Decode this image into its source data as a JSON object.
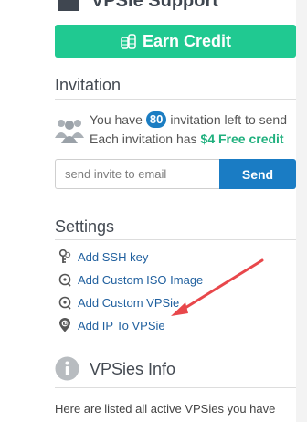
{
  "support": {
    "title": "VPSie Support",
    "icon": "headset-icon"
  },
  "earn": {
    "label": "Earn Credit",
    "icon": "coins-icon"
  },
  "invitation": {
    "title": "Invitation",
    "icon": "people-icon",
    "line1_prefix": "You have",
    "count": "80",
    "line1_suffix": "invitation left to send",
    "line2_prefix": "Each invitation has",
    "free_credit": "$4 Free credit",
    "input_placeholder": "send invite to email",
    "send_label": "Send"
  },
  "settings": {
    "title": "Settings",
    "items": [
      {
        "label": "Add SSH key",
        "icon": "key-icon"
      },
      {
        "label": "Add Custom ISO Image",
        "icon": "disc-icon"
      },
      {
        "label": "Add Custom VPSie",
        "icon": "disc-icon"
      },
      {
        "label": "Add IP To VPSie",
        "icon": "ip-pin-icon"
      }
    ]
  },
  "info": {
    "title": "VPSies Info",
    "icon": "info-icon",
    "description": "Here are listed all active VPSies you have"
  },
  "colors": {
    "accent_green": "#20c991",
    "primary_blue": "#1a7cc4",
    "link_blue": "#1f5f9e",
    "annotation_red": "#e8474b"
  }
}
